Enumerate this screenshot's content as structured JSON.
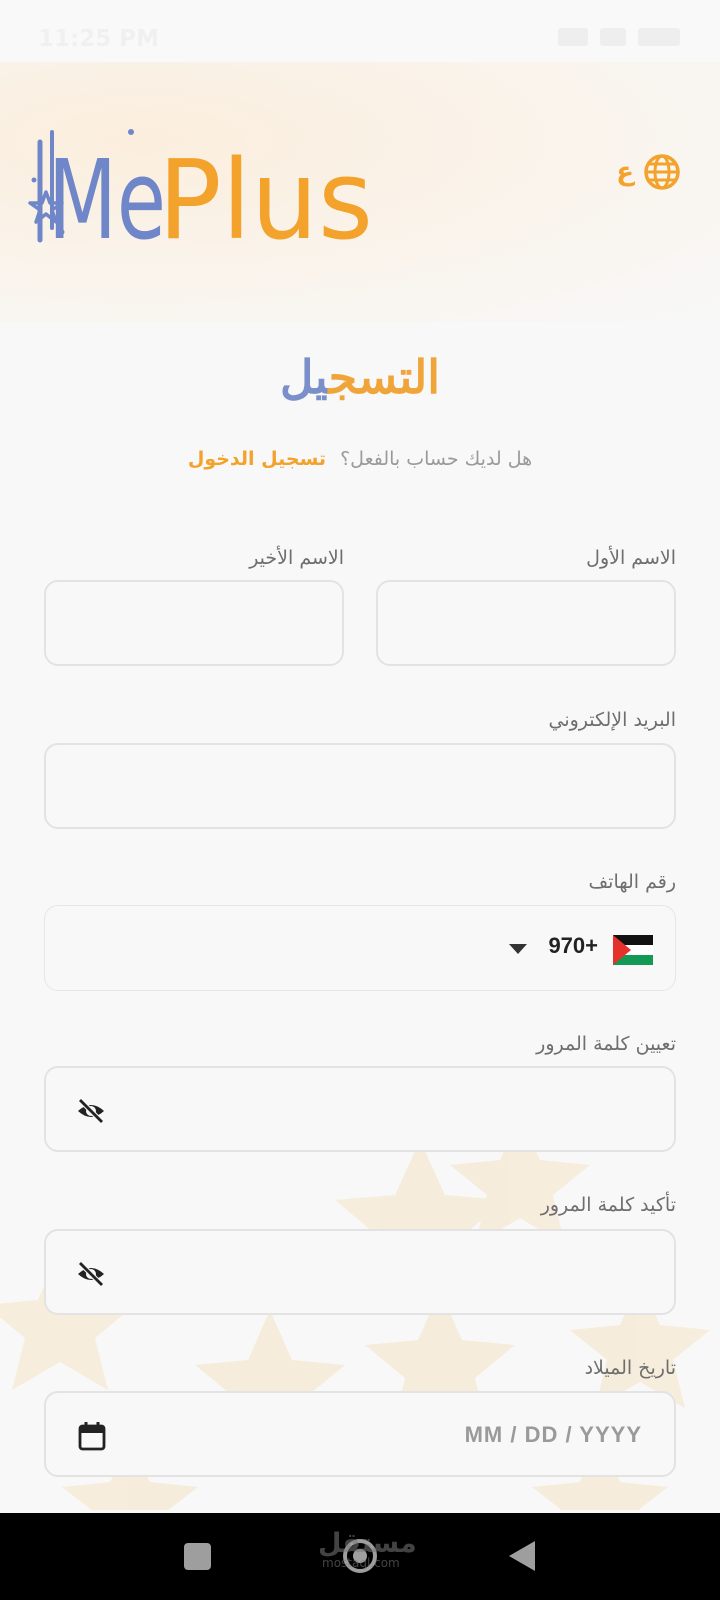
{
  "status_bar": {
    "time": "11:25 PM"
  },
  "header": {
    "logo_text_me": "Me",
    "logo_text_plus": "Plus",
    "lang_label": "ع"
  },
  "page": {
    "title_part1": "التسج",
    "title_part2": "يل",
    "have_account": "هل لديك حساب بالفعل؟",
    "login_link": "تسجيل الدخول"
  },
  "form": {
    "first_name_label": "الاسم الأول",
    "first_name_value": "",
    "last_name_label": "الاسم الأخير",
    "last_name_value": "",
    "email_label": "البريد الإلكتروني",
    "email_value": "",
    "phone_label": "رقم الهاتف",
    "phone_code": "970+",
    "password_label": "تعيين كلمة المرور",
    "password_value": "",
    "confirm_label": "تأكيد كلمة المرور",
    "confirm_value": "",
    "birthdate_label": "تاريخ الميلاد",
    "birthdate_placeholder": "MM / DD / YYYY"
  },
  "watermark": {
    "text": "مستقل",
    "sub": "mostaql.com"
  },
  "colors": {
    "accent_orange": "#f3a22c",
    "accent_blue": "#6f86c9",
    "background": "#f8f8f8"
  },
  "icons": {
    "lang": "globe-icon",
    "password_toggle": "eye-off-icon",
    "date": "calendar-icon",
    "dial": "palestine-flag-icon"
  }
}
